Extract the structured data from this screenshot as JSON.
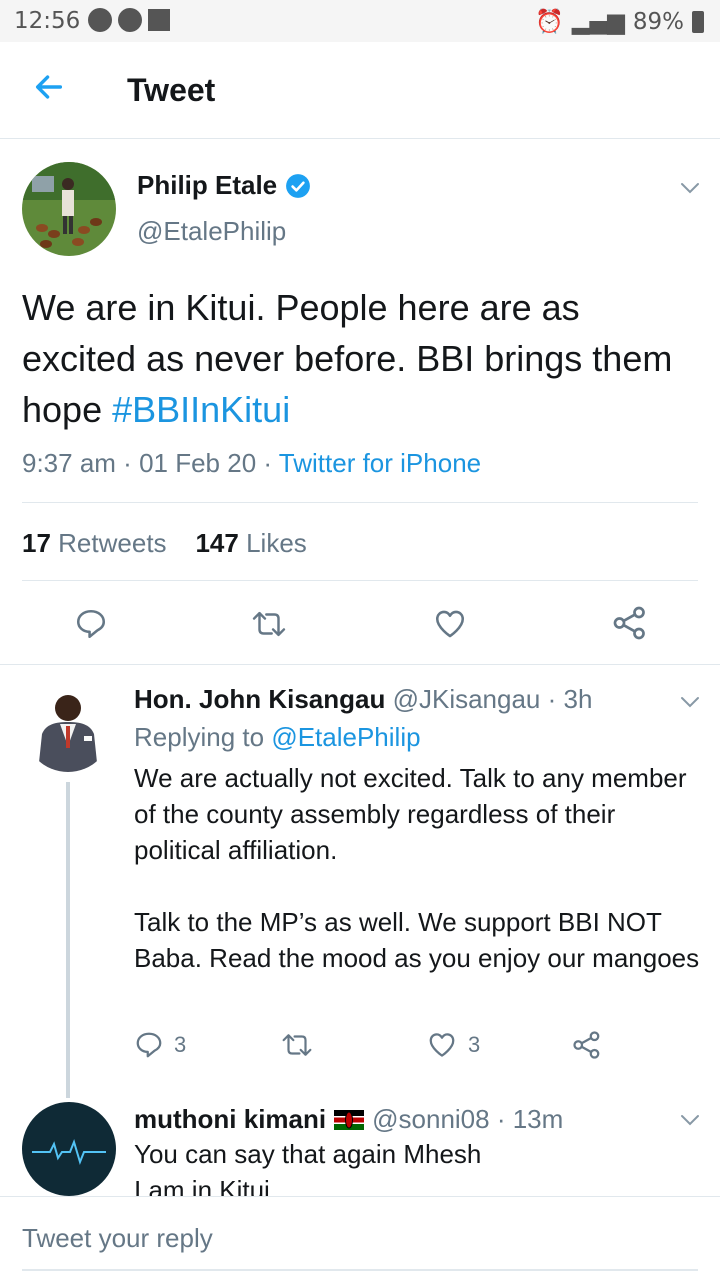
{
  "status_bar": {
    "time": "12:56",
    "battery": "89%"
  },
  "header": {
    "title": "Tweet"
  },
  "tweet": {
    "name": "Philip Etale",
    "handle": "@EtalePhilip",
    "text": "We are in Kitui. People here are as excited as never before. BBI brings them hope ",
    "hashtag": "#BBIInKitui",
    "time": "9:37 am",
    "date": "01 Feb 20",
    "source": "Twitter for iPhone",
    "retweets_count": "17",
    "retweets_label": "Retweets",
    "likes_count": "147",
    "likes_label": "Likes"
  },
  "replies": [
    {
      "name": "Hon. John Kisangau",
      "handle": "@JKisangau",
      "age": "3h",
      "replying_label": "Replying to",
      "replying_to": "@EtalePhilip",
      "text1": "We are actually not excited. Talk to any member of the county assembly regardless of their political affiliation.",
      "text2": "Talk to the MP’s as well. We support BBI NOT Baba. Read the mood as you enjoy our mangoes",
      "reply_count": "3",
      "like_count": "3"
    },
    {
      "name": "muthoni kimani",
      "handle": "@sonni08",
      "age": "13m",
      "line1": "You can say that again Mhesh",
      "line2": "I am in Kitui"
    }
  ],
  "reply_box": {
    "placeholder": "Tweet your reply"
  },
  "colors": {
    "accent": "#1b95e0",
    "muted": "#657786",
    "divider": "#e1e8ed"
  },
  "icons": [
    "back-arrow-icon",
    "verified-badge-icon",
    "chevron-down-icon",
    "reply-icon",
    "retweet-icon",
    "like-icon",
    "share-icon",
    "kenya-flag-icon"
  ]
}
